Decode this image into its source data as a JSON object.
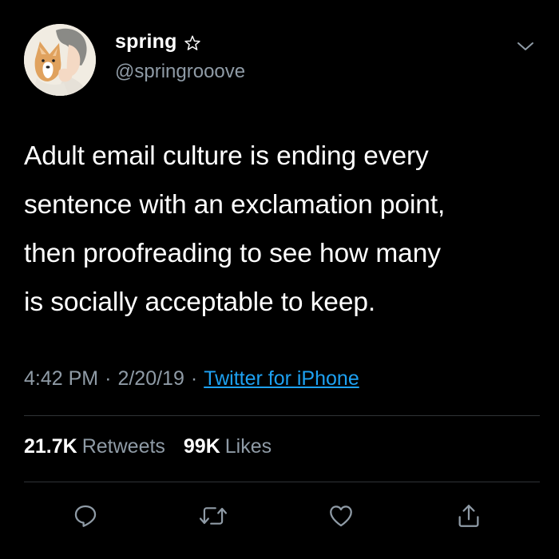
{
  "user": {
    "display_name": "spring",
    "handle": "@springrooove",
    "star_icon": "outline-star-icon",
    "avatar": "illustrated-avatar-with-corgi"
  },
  "tweet": {
    "text_lines": [
      "Adult email culture is ending every",
      "sentence with an exclamation point,",
      "then proofreading to see how many",
      "is socially acceptable to keep."
    ]
  },
  "meta": {
    "time": "4:42 PM",
    "date": "2/20/19",
    "separator": "·",
    "source": "Twitter for iPhone"
  },
  "stats": {
    "retweets_count": "21.7K",
    "retweets_label": "Retweets",
    "likes_count": "99K",
    "likes_label": "Likes"
  },
  "actions": {
    "reply_icon": "reply-icon",
    "retweet_icon": "retweet-icon",
    "like_icon": "heart-icon",
    "share_icon": "share-icon"
  },
  "colors": {
    "background": "#000000",
    "text": "#ffffff",
    "secondary_text": "#8f9ba6",
    "link": "#1da1f2",
    "divider": "#2f3336"
  }
}
